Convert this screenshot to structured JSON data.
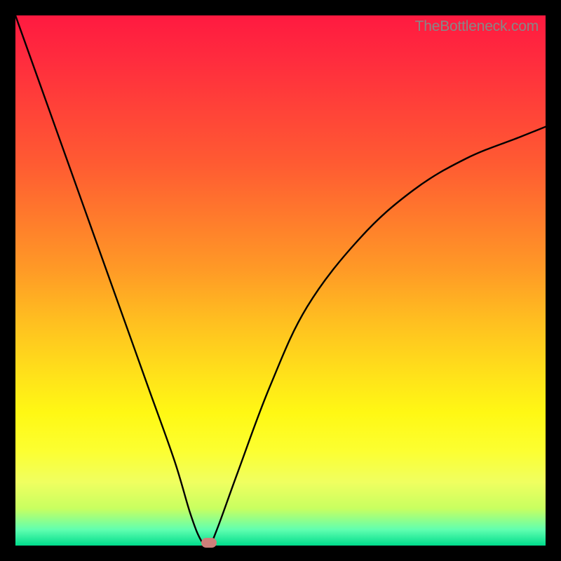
{
  "watermark": "TheBottleneck.com",
  "chart_data": {
    "type": "line",
    "title": "",
    "xlabel": "",
    "ylabel": "",
    "xlim": [
      0,
      100
    ],
    "ylim": [
      0,
      100
    ],
    "grid": false,
    "legend": false,
    "series": [
      {
        "name": "bottleneck-curve",
        "x": [
          0,
          5,
          10,
          15,
          20,
          25,
          30,
          33,
          35,
          36.5,
          38,
          42,
          48,
          55,
          65,
          75,
          85,
          95,
          100
        ],
        "values": [
          100,
          86,
          72,
          58,
          44,
          30,
          16,
          6,
          1,
          0,
          3,
          14,
          30,
          45,
          58,
          67,
          73,
          77,
          79
        ]
      }
    ],
    "marker": {
      "x": 36.5,
      "y": 0.5,
      "color": "#cd7f7a"
    },
    "gradient_stops": [
      {
        "pos": 0,
        "color": "#ff1a40"
      },
      {
        "pos": 50,
        "color": "#ffc020"
      },
      {
        "pos": 75,
        "color": "#fff814"
      },
      {
        "pos": 100,
        "color": "#00dc8c"
      }
    ]
  }
}
